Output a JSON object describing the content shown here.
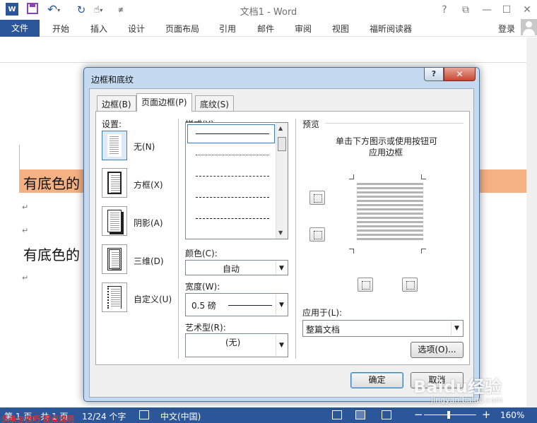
{
  "app": {
    "title": "文档1 - Word",
    "logo_letter": "W",
    "login": "登录"
  },
  "ribbon": {
    "file": "文件",
    "tabs": [
      "开始",
      "插入",
      "设计",
      "页面布局",
      "引用",
      "邮件",
      "审阅",
      "视图",
      "福昕阅读器"
    ]
  },
  "document": {
    "line1": "有底色的",
    "line2": "有底色的",
    "para_mark": "↵",
    "highlight_color": "#f4b183"
  },
  "dialog": {
    "title": "边框和底纹",
    "help": "?",
    "close": "✕",
    "tabs": [
      "边框(B)",
      "页面边框(P)",
      "底纹(S)"
    ],
    "settings_label": "设置:",
    "settings": [
      "无(N)",
      "方框(X)",
      "阴影(A)",
      "三维(D)",
      "自定义(U)"
    ],
    "style_label": "样式(Y):",
    "color_label": "颜色(C):",
    "color_value": "自动",
    "width_label": "宽度(W):",
    "width_value": "0.5 磅",
    "art_label": "艺术型(R):",
    "art_value": "(无)",
    "preview_label": "预览",
    "preview_hint_1": "单击下方图示或使用按钮可",
    "preview_hint_2": "应用边框",
    "apply_label": "应用于(L):",
    "apply_value": "整篇文档",
    "options_button": "选项(O)...",
    "ok_button": "确定",
    "cancel_button": "取消"
  },
  "status": {
    "page": "第 1 页，共 1 页",
    "words": "12/24 个字",
    "language": "中文(中国)",
    "zoom": "160%"
  },
  "watermarks": {
    "left": "头条@技巧 提点说明",
    "baidu": "Baidu经验",
    "jingyan": "jingyan.baidu.com"
  },
  "colors": {
    "word_blue": "#2b579a",
    "dialog_frame": "#c5daf0"
  }
}
